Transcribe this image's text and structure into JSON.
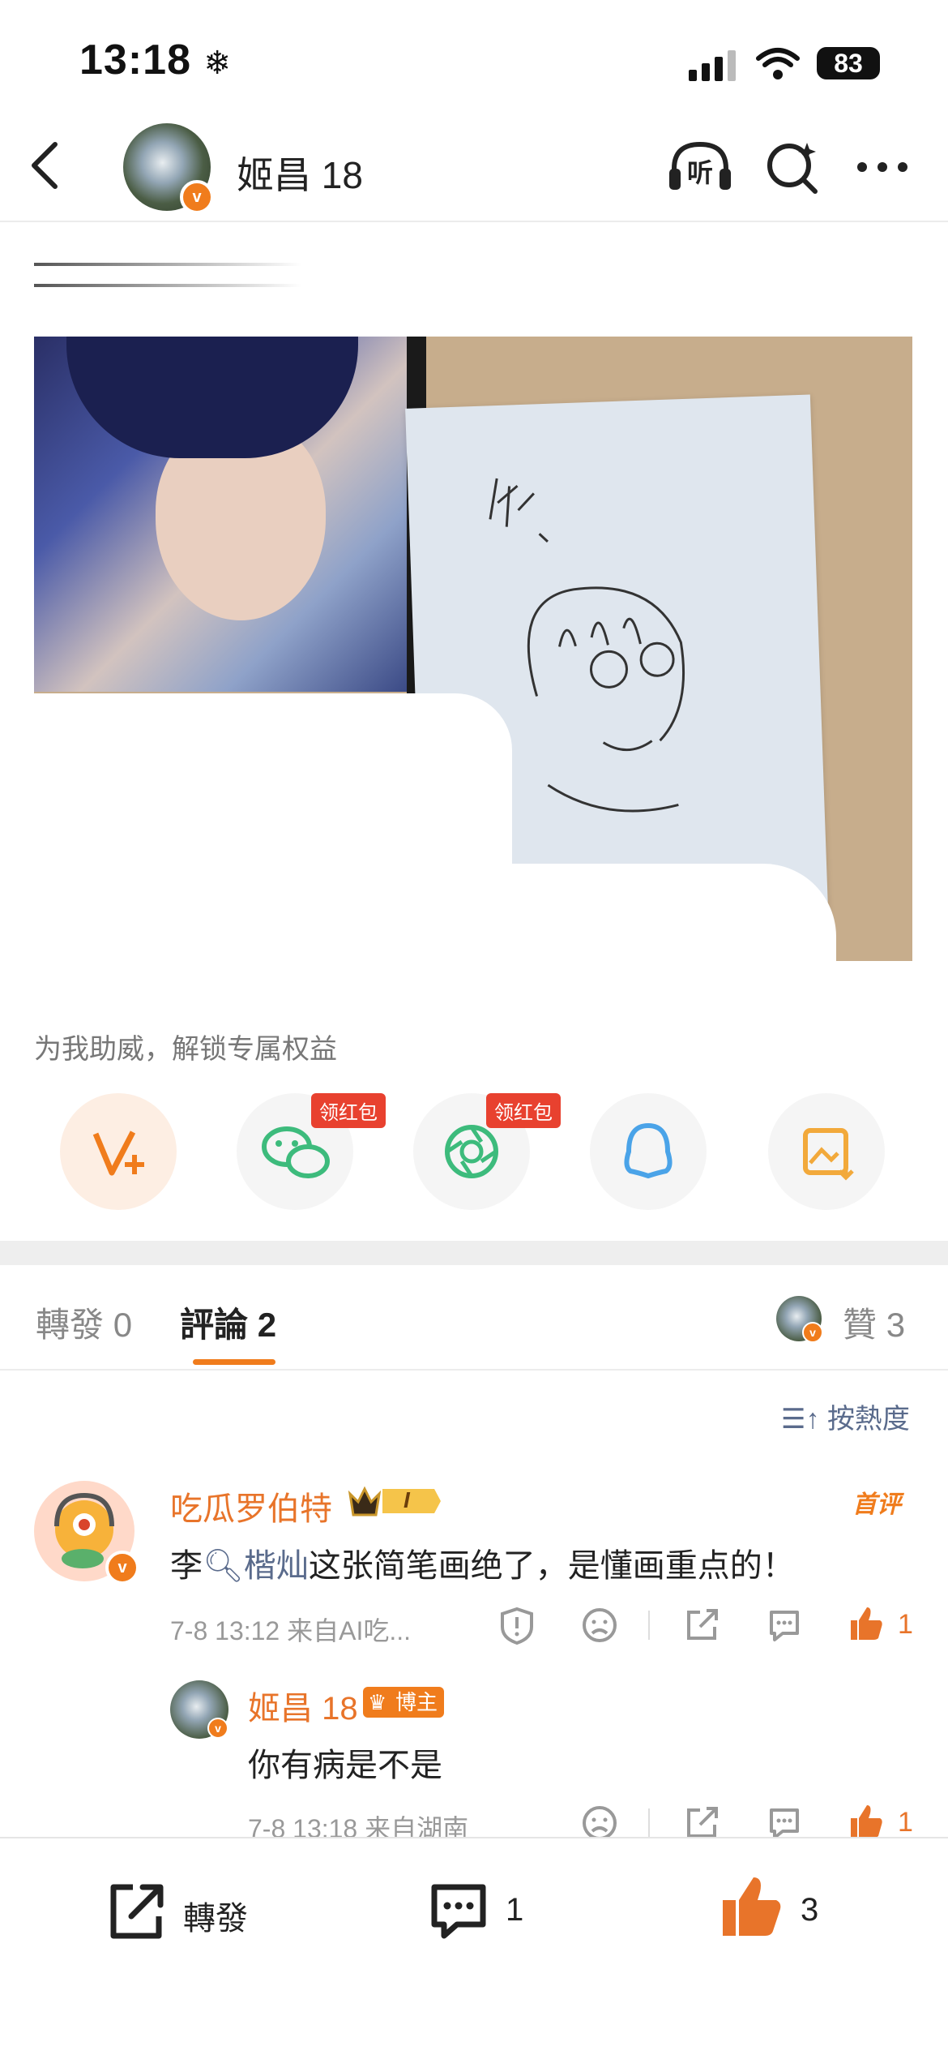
{
  "status": {
    "time": "13:18",
    "battery": "83"
  },
  "header": {
    "name": "姬昌 18",
    "listen": "听"
  },
  "post": {
    "promo": "为我助威，解锁专属权益"
  },
  "share": {
    "badge1": "领红包",
    "badge2": "领红包"
  },
  "tabs": {
    "repost_label": "轉發",
    "repost_count": "0",
    "comment_label": "評論",
    "comment_count": "2",
    "like_label": "贊",
    "like_count": "3"
  },
  "sort": {
    "label": "按熱度"
  },
  "comments": [
    {
      "name": "吃瓜罗伯特",
      "level": "I",
      "first_badge": "首评",
      "text_prefix": "李",
      "text_link": "楷灿",
      "text_suffix": "这张简笔画绝了，是懂画重点的！",
      "meta": "7-8 13:12  来自AI吃...",
      "likes": "1"
    },
    {
      "name": "姬昌 18",
      "role": "博主",
      "text": "你有病是不是",
      "meta": "7-8 13:18  来自湖南",
      "likes": "1"
    }
  ],
  "bottom": {
    "repost": "轉發",
    "comment_count": "1",
    "like_count": "3"
  },
  "colors": {
    "accent": "#f07c1c",
    "link": "#5a6b8c",
    "wechat": "#3dbb7c",
    "qq": "#4aa3e8",
    "image": "#f2a93b"
  }
}
